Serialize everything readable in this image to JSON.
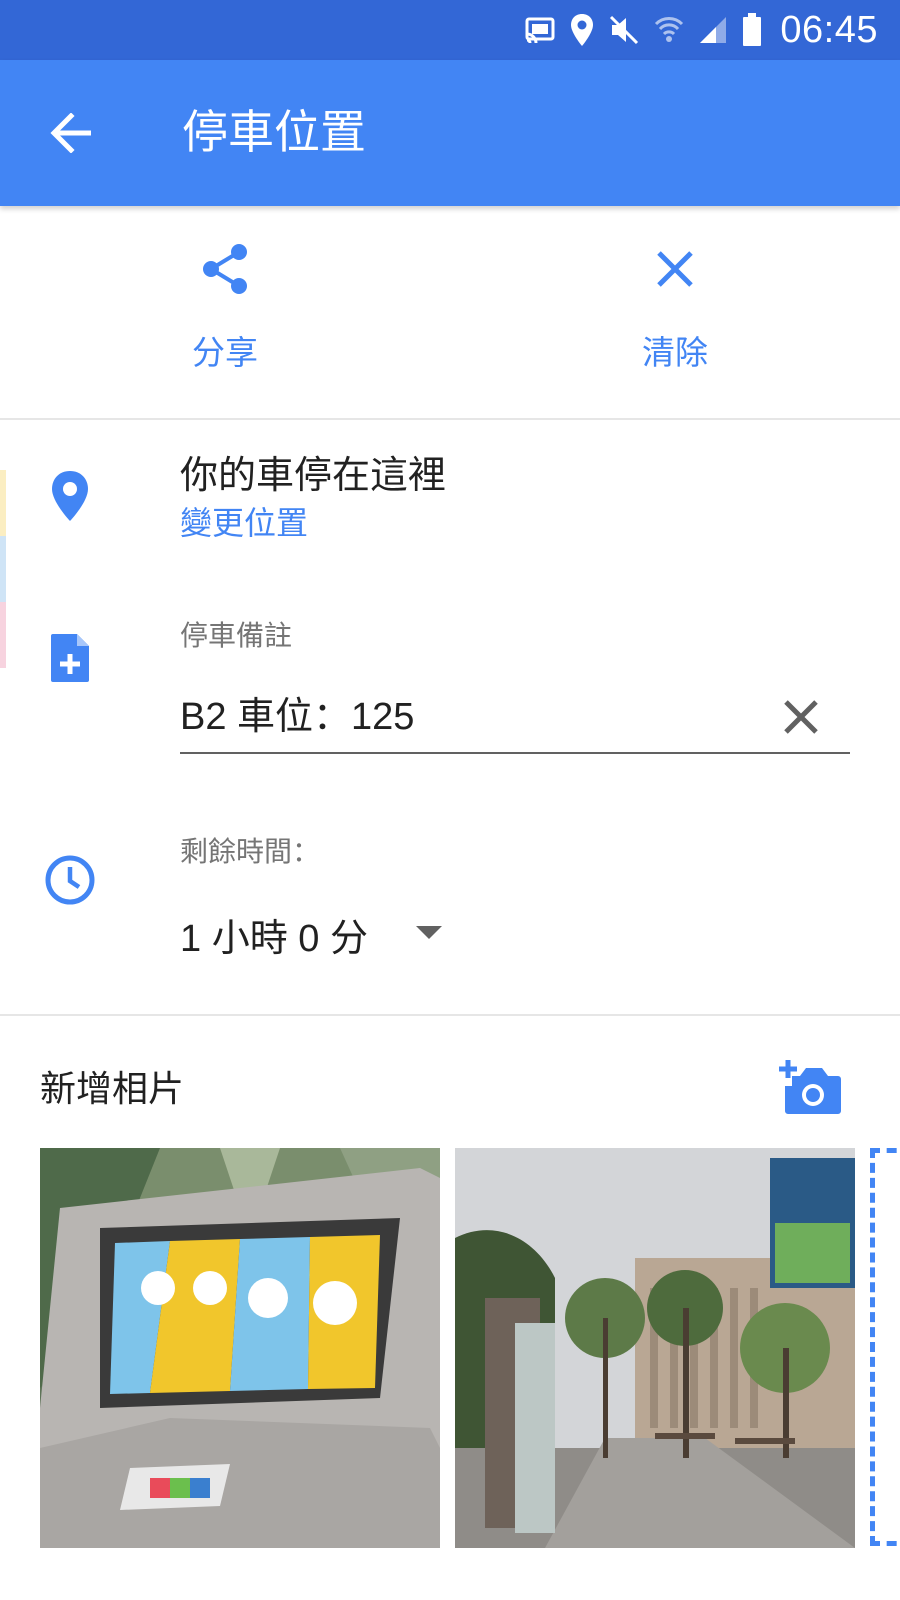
{
  "status_bar": {
    "time": "06:45",
    "icons": [
      "cast-icon",
      "location-icon",
      "mute-icon",
      "wifi-icon",
      "signal-icon",
      "battery-icon"
    ],
    "color": "#3367d6"
  },
  "app_bar": {
    "title": "停車位置",
    "color": "#4285f4"
  },
  "actions": {
    "share_label": "分享",
    "clear_label": "清除"
  },
  "location": {
    "title": "你的車停在這裡",
    "change_label": "變更位置"
  },
  "note": {
    "label": "停車備註",
    "value": "B2 車位：125"
  },
  "time_remaining": {
    "label": "剩餘時間：",
    "value": "1 小時 0 分"
  },
  "photos": {
    "title": "新增相片"
  },
  "colors": {
    "accent": "#4285f4",
    "text_primary": "#212121",
    "text_secondary": "#757575"
  }
}
